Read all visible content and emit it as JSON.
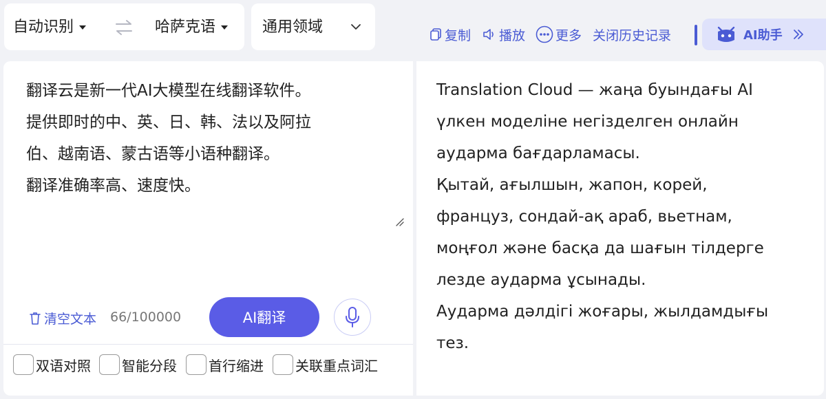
{
  "lang_bar": {
    "source_lang": "自动识别",
    "target_lang": "哈萨克语",
    "domain": "通用领域"
  },
  "toolbar": {
    "copy": "复制",
    "play": "播放",
    "more": "更多",
    "history": "关闭历史记录",
    "ai_assistant": "AI助手"
  },
  "source": {
    "lines": [
      "翻译云是新一代AI大模型在线翻译软件。",
      "提供即时的中、英、日、韩、法以及阿拉",
      "伯、越南语、蒙古语等小语种翻译。",
      "翻译准确率高、速度快。"
    ],
    "clear_label": "清空文本",
    "char_count": "66/100000",
    "translate_label": "AI翻译"
  },
  "options": [
    {
      "label": "双语对照",
      "checked": false
    },
    {
      "label": "智能分段",
      "checked": false
    },
    {
      "label": "首行缩进",
      "checked": false
    },
    {
      "label": "关联重点词汇",
      "checked": false
    }
  ],
  "target": {
    "lines": [
      "Translation Cloud — жаңа буындағы AI",
      "үлкен моделіне негізделген онлайн",
      "аударма бағдарламасы.",
      "Қытай, ағылшын, жапон, корей,",
      "француз, сондай-ақ араб, вьетнам,",
      "моңғол және басқа да шағын тілдерге",
      "лезде аударма ұсынады.",
      "Аударма дәлдігі жоғары, жылдамдығы",
      "тез."
    ]
  },
  "colors": {
    "accent": "#4a5bd4",
    "button": "#5a5ce6",
    "background": "#f1f2f6"
  }
}
